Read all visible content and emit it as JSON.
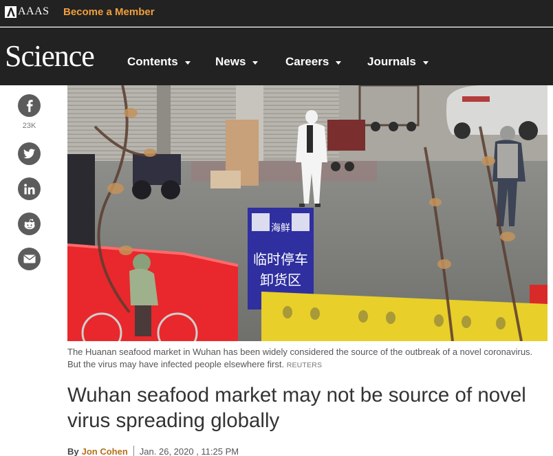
{
  "topbar": {
    "aaas_logo": "AAAS",
    "member_link": "Become a Member"
  },
  "navbar": {
    "logo": "Science",
    "items": [
      {
        "label": "Contents"
      },
      {
        "label": "News"
      },
      {
        "label": "Careers"
      },
      {
        "label": "Journals"
      }
    ]
  },
  "share": {
    "facebook_count": "23K",
    "buttons": [
      "facebook-icon",
      "twitter-icon",
      "linkedin-icon",
      "reddit-icon",
      "email-icon"
    ]
  },
  "hero": {
    "sign_top": "海鲜",
    "sign_line1": "临时停车",
    "sign_line2": "卸货区"
  },
  "article": {
    "caption": "The Huanan seafood market in Wuhan has been widely considered the source of the outbreak of a novel coronavirus. But the virus may have infected people elsewhere first.",
    "credit": "REUTERS",
    "headline": "Wuhan seafood market may not be source of novel virus spreading globally",
    "byline_prefix": "By",
    "author": "Jon Cohen",
    "date": "Jan. 26, 2020 , 11:25 PM"
  },
  "colors": {
    "header_bg": "#222222",
    "accent_orange": "#f0a03c",
    "author_link": "#b46f18",
    "share_icon_bg": "#5c5c5c"
  }
}
